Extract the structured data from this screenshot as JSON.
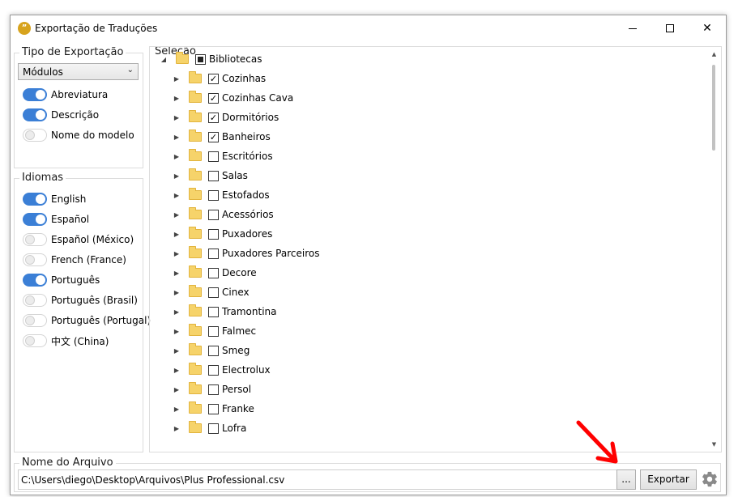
{
  "window": {
    "title": "Exportação de Traduções",
    "icon": "speech-bubble-icon"
  },
  "export_type": {
    "legend": "Tipo de Exportação",
    "select_value": "Módulos",
    "toggles": [
      {
        "label": "Abreviatura",
        "on": true
      },
      {
        "label": "Descrição",
        "on": true
      },
      {
        "label": "Nome do modelo",
        "on": false
      }
    ]
  },
  "languages": {
    "legend": "Idiomas",
    "toggles": [
      {
        "label": "English",
        "on": true
      },
      {
        "label": "Español",
        "on": true
      },
      {
        "label": "Español (México)",
        "on": false
      },
      {
        "label": "French (France)",
        "on": false
      },
      {
        "label": "Português",
        "on": true
      },
      {
        "label": "Português (Brasil)",
        "on": false
      },
      {
        "label": "Português (Portugal)",
        "on": false
      },
      {
        "label": "中文 (China)",
        "on": false
      }
    ]
  },
  "selection": {
    "legend": "Seleção",
    "root": {
      "label": "Bibliotecas",
      "state": "partial"
    },
    "items": [
      {
        "label": "Cozinhas",
        "checked": true
      },
      {
        "label": "Cozinhas Cava",
        "checked": true
      },
      {
        "label": "Dormitórios",
        "checked": true
      },
      {
        "label": "Banheiros",
        "checked": true
      },
      {
        "label": "Escritórios",
        "checked": false
      },
      {
        "label": "Salas",
        "checked": false
      },
      {
        "label": "Estofados",
        "checked": false
      },
      {
        "label": "Acessórios",
        "checked": false
      },
      {
        "label": "Puxadores",
        "checked": false
      },
      {
        "label": "Puxadores Parceiros",
        "checked": false
      },
      {
        "label": "Decore",
        "checked": false
      },
      {
        "label": "Cinex",
        "checked": false
      },
      {
        "label": "Tramontina",
        "checked": false
      },
      {
        "label": "Falmec",
        "checked": false
      },
      {
        "label": "Smeg",
        "checked": false
      },
      {
        "label": "Electrolux",
        "checked": false
      },
      {
        "label": "Persol",
        "checked": false
      },
      {
        "label": "Franke",
        "checked": false
      },
      {
        "label": "Lofra",
        "checked": false
      }
    ]
  },
  "file": {
    "legend": "Nome do Arquivo",
    "path": "C:\\Users\\diego\\Desktop\\Arquivos\\Plus Professional.csv",
    "browse_label": "...",
    "export_label": "Exportar"
  },
  "colors": {
    "toggle_on": "#3b7fd6",
    "annotation_arrow": "#ff0000"
  }
}
